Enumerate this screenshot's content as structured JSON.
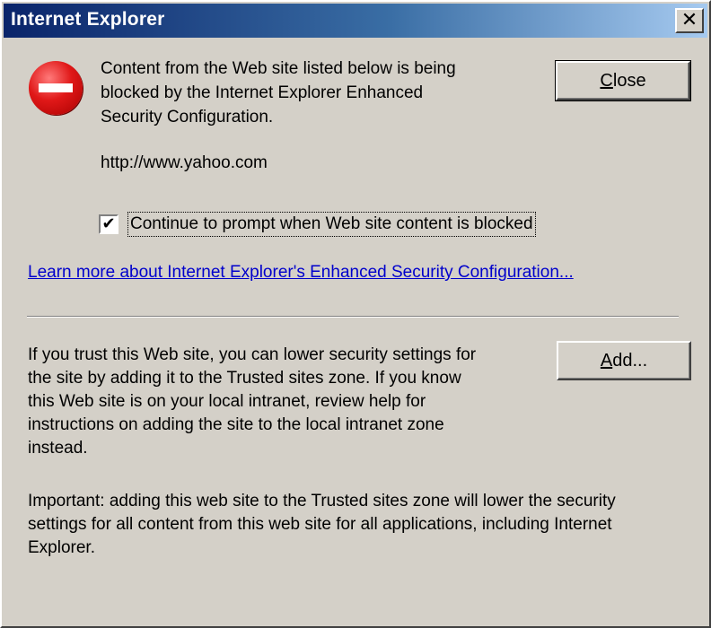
{
  "window": {
    "title": "Internet Explorer",
    "close_glyph": "✕"
  },
  "icon": {
    "name": "stop-icon",
    "color": "#e01818"
  },
  "message": {
    "line1": "Content from the Web site listed below is being",
    "line2": "blocked by the Internet Explorer Enhanced",
    "line3": "Security Configuration.",
    "url": "http://www.yahoo.com"
  },
  "checkbox": {
    "checked": true,
    "mark": "✔",
    "label": "Continue to prompt when Web site content is blocked"
  },
  "link": {
    "text": "Learn more about Internet Explorer's Enhanced Security Configuration..."
  },
  "trust": {
    "lines": [
      "If you trust this Web site, you can lower security settings for",
      "the site by adding it to the Trusted sites zone. If you know",
      "this Web site is on your local intranet, review help for",
      "instructions on adding the site to the local intranet zone",
      "instead."
    ]
  },
  "important": {
    "lines": [
      "Important: adding this web site to the Trusted sites zone will lower the security",
      "settings for all content from this web site for all applications, including Internet",
      "Explorer."
    ]
  },
  "buttons": {
    "close": {
      "accel": "C",
      "rest": "lose"
    },
    "add": {
      "accel": "A",
      "rest": "dd..."
    }
  }
}
